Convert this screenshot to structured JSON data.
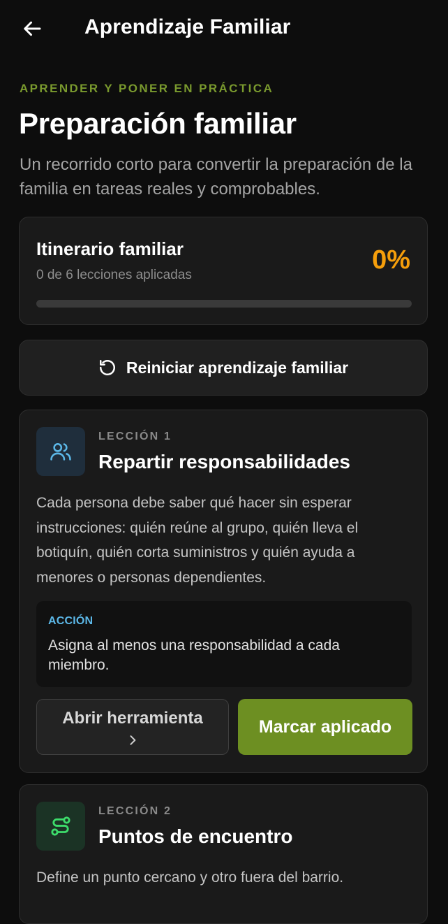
{
  "header": {
    "back_icon": "arrow-left-icon",
    "title": "Aprendizaje Familiar"
  },
  "intro": {
    "eyebrow": "APRENDER Y PONER EN PRÁCTICA",
    "title": "Preparación familiar",
    "description": "Un recorrido corto para convertir la preparación de la familia en tareas reales y comprobables."
  },
  "progress": {
    "title": "Itinerario familiar",
    "subtitle": "0 de 6 lecciones aplicadas",
    "percent_label": "0%",
    "fraction": 0,
    "accent_color": "#f59e0b"
  },
  "reset": {
    "icon": "rotate-ccw-icon",
    "label": "Reiniciar aprendizaje familiar"
  },
  "lessons": [
    {
      "icon": "users-icon",
      "kicker": "LECCIÓN 1",
      "title": "Repartir responsabilidades",
      "body": "Cada persona debe saber qué hacer sin esperar instrucciones: quién reúne al grupo, quién lleva el botiquín, quién corta suministros y quién ayuda a menores o personas dependientes.",
      "action_label": "ACCIÓN",
      "action_text": "Asigna al menos una responsabilidad a cada miembro.",
      "open_label": "Abrir herramienta",
      "open_icon": "chevron-right-icon",
      "mark_label": "Marcar aplicado"
    },
    {
      "icon": "route-icon",
      "kicker": "LECCIÓN 2",
      "title": "Puntos de encuentro",
      "body": "Define un punto cercano y otro fuera del barrio."
    }
  ],
  "colors": {
    "background": "#0d0d0d",
    "card": "#1a1a1a",
    "brand_green": "#6d8f22",
    "eyebrow_green": "#7a9a2e",
    "action_blue": "#5cb8e8",
    "progress_orange": "#f59e0b"
  }
}
